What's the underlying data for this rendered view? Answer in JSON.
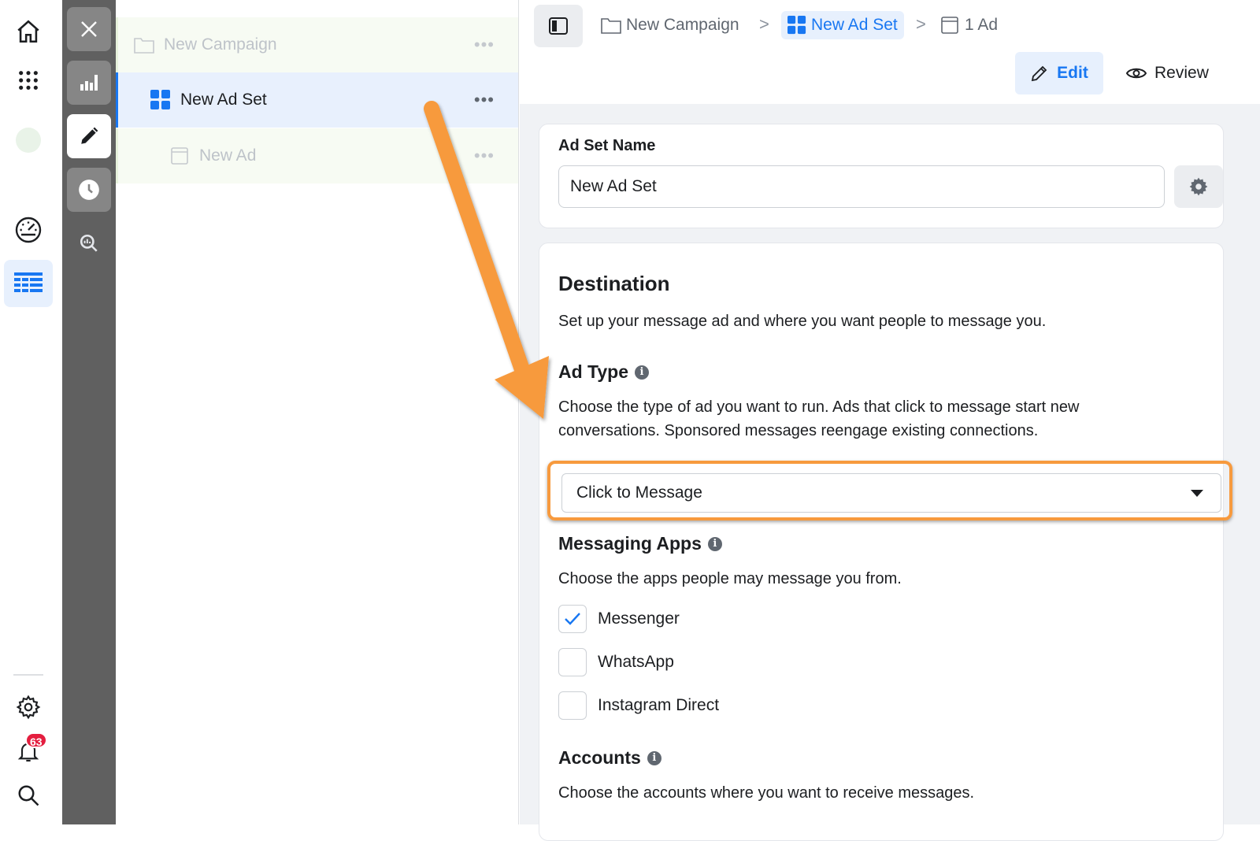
{
  "global_nav": {
    "items": [
      {
        "name": "home-icon"
      },
      {
        "name": "apps-grid-icon"
      },
      {
        "name": "account-avatar"
      },
      {
        "name": "dashboard-gauge-icon"
      },
      {
        "name": "ads-manager-table-icon",
        "active": true
      }
    ],
    "bottom_items": [
      {
        "name": "settings-icon"
      },
      {
        "name": "notifications-bell-icon",
        "badge": "63"
      },
      {
        "name": "search-icon"
      }
    ]
  },
  "tool_column": {
    "items": [
      "close-icon",
      "charts-icon",
      "edit-pencil-icon",
      "history-clock-icon",
      "inspect-icon"
    ]
  },
  "tree": {
    "campaign": {
      "label": "New Campaign",
      "more": "•••"
    },
    "adset": {
      "label": "New Ad Set",
      "more": "•••"
    },
    "ad": {
      "label": "New Ad",
      "more": "•••"
    }
  },
  "breadcrumb": {
    "campaign": "New Campaign",
    "adset": "New Ad Set",
    "ads": "1 Ad"
  },
  "mode": {
    "edit_label": "Edit",
    "review_label": "Review"
  },
  "ad_set_name": {
    "label": "Ad Set Name",
    "value": "New Ad Set"
  },
  "destination": {
    "title": "Destination",
    "description": "Set up your message ad and where you want people to message you.",
    "ad_type": {
      "title": "Ad Type",
      "description_line1": "Choose the type of ad you want to run. Ads that click to message start new",
      "description_line2": "conversations. Sponsored messages reengage existing connections.",
      "selected": "Click to Message"
    },
    "messaging_apps": {
      "title": "Messaging Apps",
      "description": "Choose the apps people may message you from.",
      "options": [
        {
          "label": "Messenger",
          "checked": true
        },
        {
          "label": "WhatsApp",
          "checked": false
        },
        {
          "label": "Instagram Direct",
          "checked": false
        }
      ]
    },
    "accounts": {
      "title": "Accounts",
      "description": "Choose the accounts where you want to receive messages."
    }
  },
  "colors": {
    "accent": "#1877f2",
    "highlight": "#f79a3e",
    "tool_column": "#606060",
    "badge": "#e41e3f"
  }
}
